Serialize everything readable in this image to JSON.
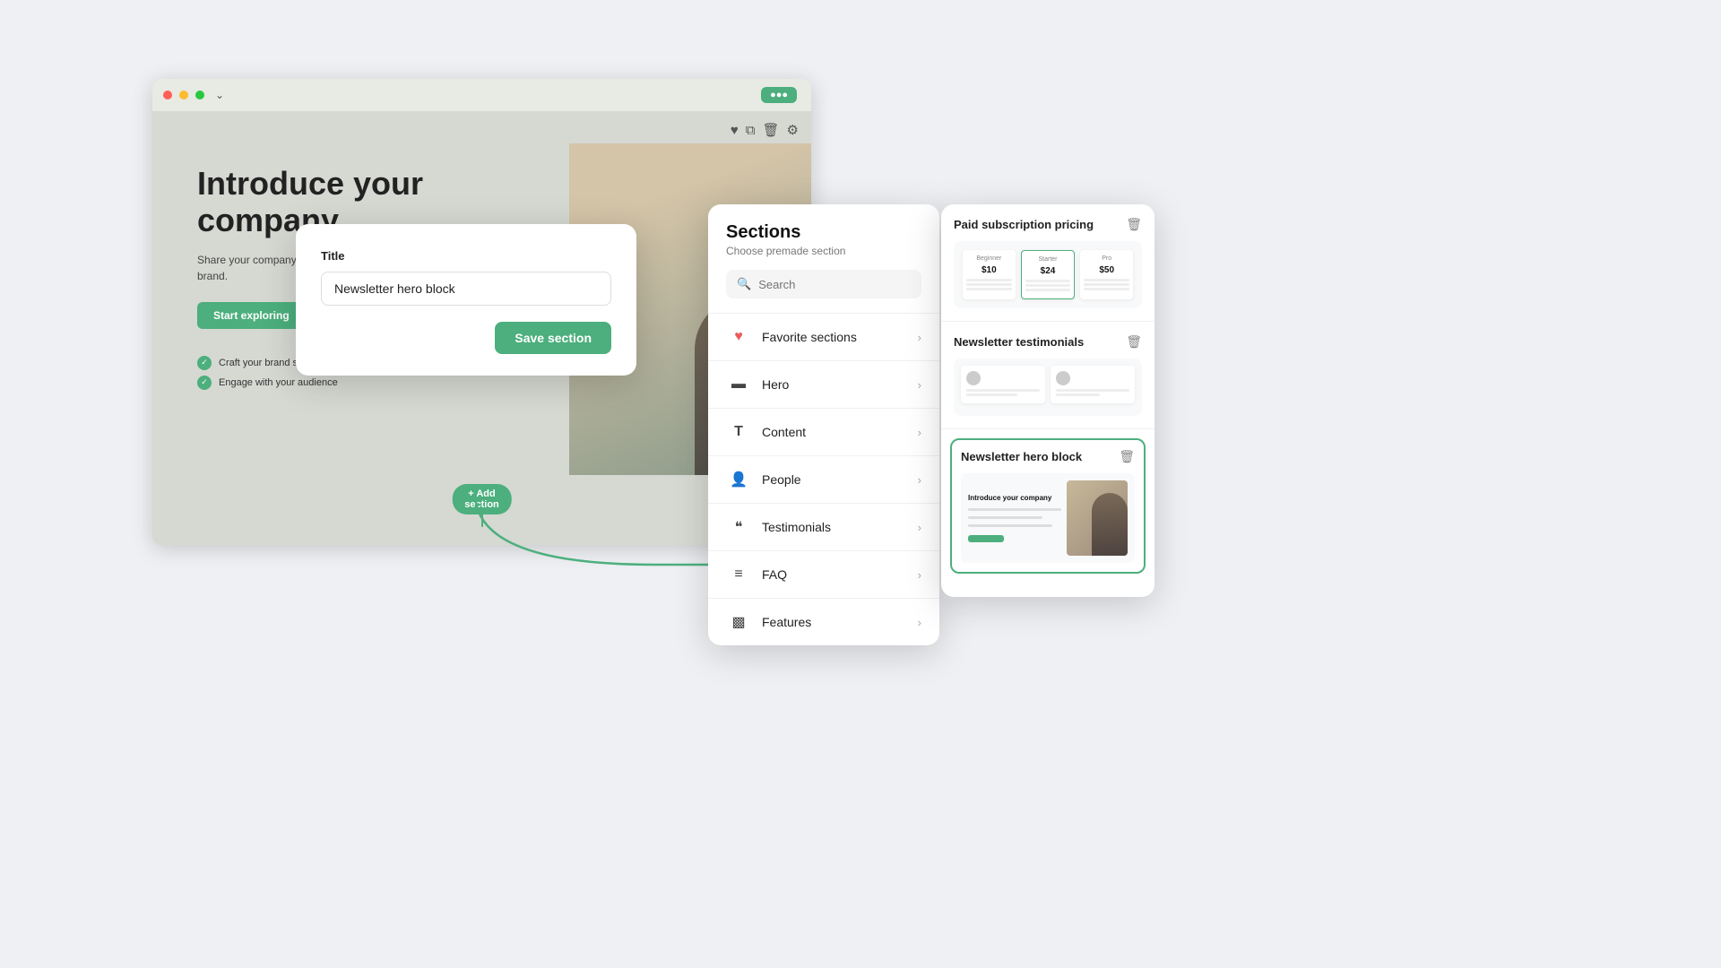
{
  "background": {
    "color": "#eef0f3"
  },
  "website_preview": {
    "heading": "Introduce your company",
    "subtext": "Share your company story and introduce your brand.",
    "cta_label": "Start exploring",
    "checks": [
      "Craft your brand story",
      "Engage with your audience"
    ],
    "add_section_label": "+ Add section",
    "topbar_btn": "●●●"
  },
  "modal": {
    "title_label": "Title",
    "input_value": "Newsletter hero block",
    "save_button_label": "Save section"
  },
  "sections_panel": {
    "title": "Sections",
    "subtitle": "Choose premade section",
    "search_placeholder": "Search",
    "items": [
      {
        "id": "favorite",
        "label": "Favorite sections",
        "icon": "♥"
      },
      {
        "id": "hero",
        "label": "Hero",
        "icon": "▬"
      },
      {
        "id": "content",
        "label": "Content",
        "icon": "T"
      },
      {
        "id": "people",
        "label": "People",
        "icon": "👤"
      },
      {
        "id": "testimonials",
        "label": "Testimonials",
        "icon": "❝"
      },
      {
        "id": "faq",
        "label": "FAQ",
        "icon": "≡"
      },
      {
        "id": "features",
        "label": "Features",
        "icon": "▩"
      }
    ]
  },
  "preview_panel": {
    "cards": [
      {
        "id": "pricing",
        "title": "Paid subscription pricing",
        "highlighted": false
      },
      {
        "id": "testimonials",
        "title": "Newsletter testimonials",
        "highlighted": false
      },
      {
        "id": "newsletter_hero",
        "title": "Newsletter hero block",
        "highlighted": true
      }
    ]
  },
  "icons": {
    "search": "🔍",
    "chevron_right": "›",
    "heart": "♥",
    "hero_block": "▬",
    "content": "T",
    "people": "👤",
    "quote": "❝",
    "faq": "≡",
    "features": "▩",
    "trash": "🗑",
    "check": "✓"
  }
}
